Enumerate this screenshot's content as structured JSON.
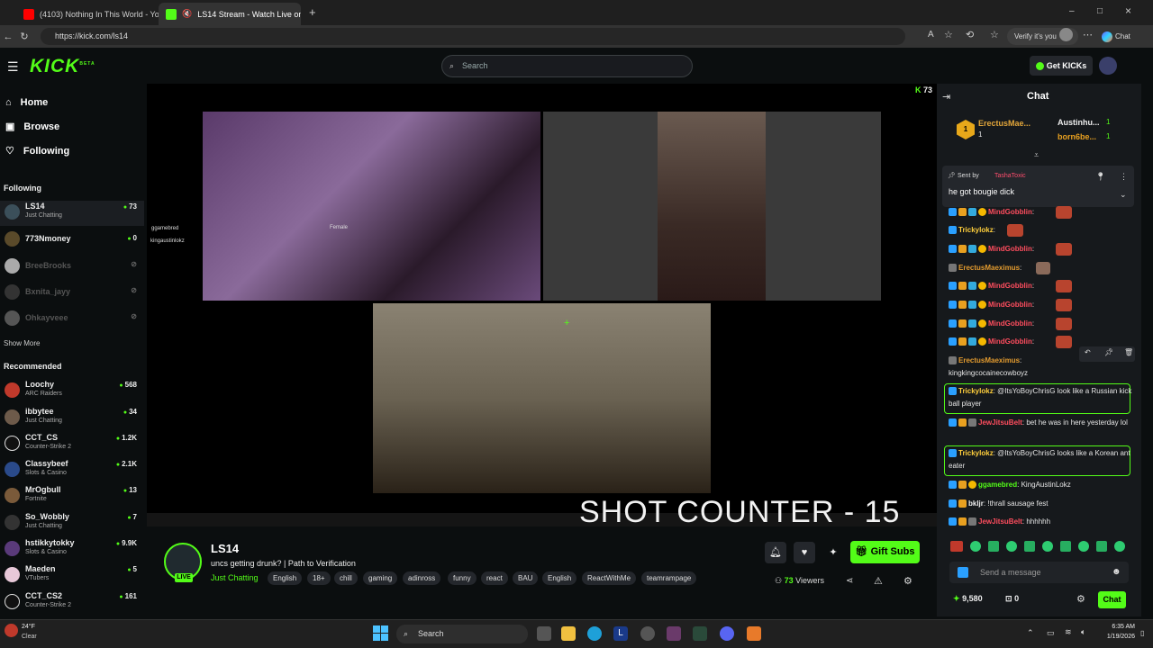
{
  "browser": {
    "tabs": [
      {
        "title": "(4103) Nothing In This World - Yo",
        "close": "×"
      },
      {
        "title": "LS14 Stream - Watch Live on",
        "close": "×"
      }
    ],
    "new_tab": "+",
    "url": "https://kick.com/ls14",
    "verify": "Verify it's you",
    "chat": "Chat",
    "window_controls": [
      "–",
      "□",
      "×"
    ]
  },
  "header": {
    "logo": "KICK",
    "logo_beta": "BETA",
    "search_placeholder": "Search",
    "get_kicks": "Get KICKs"
  },
  "sidebar": {
    "nav": [
      {
        "label": "Home",
        "icon": "home-icon"
      },
      {
        "label": "Browse",
        "icon": "browse-icon"
      },
      {
        "label": "Following",
        "icon": "heart-icon"
      }
    ],
    "following_title": "Following",
    "following": [
      {
        "name": "LS14",
        "category": "Just Chatting",
        "viewers": "73"
      },
      {
        "name": "773Nmoney",
        "category": "",
        "viewers": "0"
      },
      {
        "name": "BreeBrooks",
        "category": "",
        "viewers": ""
      },
      {
        "name": "Bxnita_jayy",
        "category": "",
        "viewers": ""
      },
      {
        "name": "Ohkayveee",
        "category": "",
        "viewers": ""
      }
    ],
    "show_more": "Show More",
    "recommended_title": "Recommended",
    "recommended": [
      {
        "name": "Loochy",
        "category": "ARC Raiders",
        "viewers": "568"
      },
      {
        "name": "ibbytee",
        "category": "Just Chatting",
        "viewers": "34"
      },
      {
        "name": "CCT_CS",
        "category": "Counter-Strike 2",
        "viewers": "1.2K"
      },
      {
        "name": "Classybeef",
        "category": "Slots & Casino",
        "viewers": "2.1K"
      },
      {
        "name": "MrOgbull",
        "category": "Fortnite",
        "viewers": "13"
      },
      {
        "name": "So_Wobbly",
        "category": "Just Chatting",
        "viewers": "7"
      },
      {
        "name": "hstikkytokky",
        "category": "Slots & Casino",
        "viewers": "9.9K"
      },
      {
        "name": "Maeden",
        "category": "VTubers",
        "viewers": "5"
      },
      {
        "name": "CCT_CS2",
        "category": "Counter-Strike 2",
        "viewers": "161"
      }
    ]
  },
  "video": {
    "viewer_badge": "73",
    "overlay_name1": "ggamebred",
    "overlay_name2": "kingaustinlokz",
    "overlay_gender": "Female",
    "shot_counter": "SHOT COUNTER - 15"
  },
  "stream": {
    "channel": "LS14",
    "live": "LIVE",
    "title": "uncs getting drunk? | Path to Verification",
    "category": "Just Chatting",
    "tags": [
      "English",
      "18+",
      "chill",
      "gaming",
      "adinross",
      "funny",
      "react",
      "BAU",
      "English",
      "ReactWithMe",
      "teamrampage"
    ],
    "gift_subs": "Gift Subs",
    "viewers": "73",
    "viewers_label": "Viewers"
  },
  "chat": {
    "title": "Chat",
    "leaderboard": [
      {
        "name": "ErectusMae...",
        "count": "1"
      },
      {
        "name": "Austinhu...",
        "count": "1"
      },
      {
        "name": "born6be...",
        "count": "1"
      }
    ],
    "pinned_sent_by": "Sent by",
    "pinned_user": "TashaToxic",
    "pinned_text": "he got bougie dick",
    "messages": [
      {
        "user": "MindGobblin",
        "color": "#ff4d5e",
        "text": ""
      },
      {
        "user": "Trickylokz",
        "color": "#ffcf3c",
        "text": ""
      },
      {
        "user": "MindGobblin",
        "color": "#ff4d5e",
        "text": ""
      },
      {
        "user": "ErectusMaeximus",
        "color": "#e39b2f",
        "text": ""
      },
      {
        "user": "MindGobblin",
        "color": "#ff4d5e",
        "text": ""
      },
      {
        "user": "MindGobblin",
        "color": "#ff4d5e",
        "text": ""
      },
      {
        "user": "MindGobblin",
        "color": "#ff4d5e",
        "text": ""
      },
      {
        "user": "MindGobblin",
        "color": "#ff4d5e",
        "text": ""
      }
    ],
    "msg_erectus_user": "ErectusMaeximus",
    "msg_erectus_text": "kingkingcocainecowboyz",
    "msg_tricky1_user": "Trickylokz",
    "msg_tricky1_text": "@ItsYoBoyChrisG look like a Russian kick ball player",
    "msg_jew1_user": "JewJitsuBelt",
    "msg_jew1_text": "bet he was in here yesterday lol",
    "msg_tricky2_user": "Trickylokz",
    "msg_tricky2_text": "@ItsYoBoyChrisG looks like a Korean ant eater",
    "msg_gg_user": "ggamebred",
    "msg_gg_text": "KingAustinLokz",
    "msg_bk_user": "bkljr",
    "msg_bk_text": "!thrall sausage fest",
    "msg_jew2_user": "JewJitsuBelt",
    "msg_jew2_text": "hhhhhh",
    "send_placeholder": "Send a message",
    "points": "9,580",
    "redeems": "0",
    "chat_button": "Chat"
  },
  "taskbar": {
    "temp": "24°F",
    "weather": "Clear",
    "search": "Search",
    "time": "6:35 AM",
    "date": "1/19/2026"
  },
  "colors": {
    "kick_green": "#53fc18",
    "bg": "#0b0e0f",
    "chat_bg": "#16191c"
  }
}
